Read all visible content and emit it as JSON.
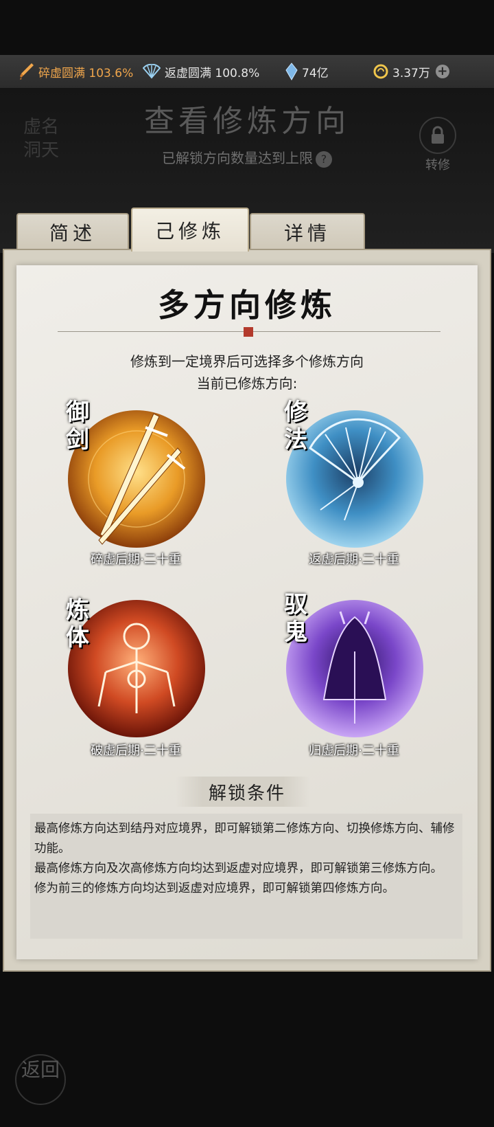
{
  "resources": [
    {
      "icon": "sword-icon",
      "text": "碎虚圆满 103.6%"
    },
    {
      "icon": "fan-icon",
      "text": "返虚圆满 100.8%"
    },
    {
      "icon": "spirit-stone-icon",
      "text": "74亿"
    },
    {
      "icon": "coin-icon",
      "text": "3.37万"
    }
  ],
  "header": {
    "title": "查看修炼方向",
    "subtitle": "已解锁方向数量达到上限",
    "help": "?",
    "seal_text": "虚名 洞天",
    "switch_label": "转修"
  },
  "tabs": [
    {
      "label": "简述",
      "active": false
    },
    {
      "label": "己修炼",
      "active": true
    },
    {
      "label": "详情",
      "active": false
    }
  ],
  "panel": {
    "title": "多方向修炼",
    "desc1": "修炼到一定境界后可选择多个修炼方向",
    "desc2": "当前已修炼方向:"
  },
  "directions": [
    {
      "tag": "御剑",
      "label": "碎虚后期·二十重",
      "color": "#e99b27"
    },
    {
      "tag": "修法",
      "label": "返虚后期·二十重",
      "color": "#3f8fc4"
    },
    {
      "tag": "炼体",
      "label": "破虚后期·二十重",
      "color": "#d04a23"
    },
    {
      "tag": "驭鬼",
      "label": "归虚后期·二十重",
      "color": "#7a47c9"
    }
  ],
  "conditions": {
    "title": "解锁条件",
    "lines": [
      "最高修炼方向达到结丹对应境界，即可解锁第二修炼方向、切换修炼方向、辅修功能。",
      "最高修炼方向及次高修炼方向均达到返虚对应境界，即可解锁第三修炼方向。",
      "修为前三的修炼方向均达到返虚对应境界，即可解锁第四修炼方向。"
    ]
  },
  "back_label": "返回"
}
